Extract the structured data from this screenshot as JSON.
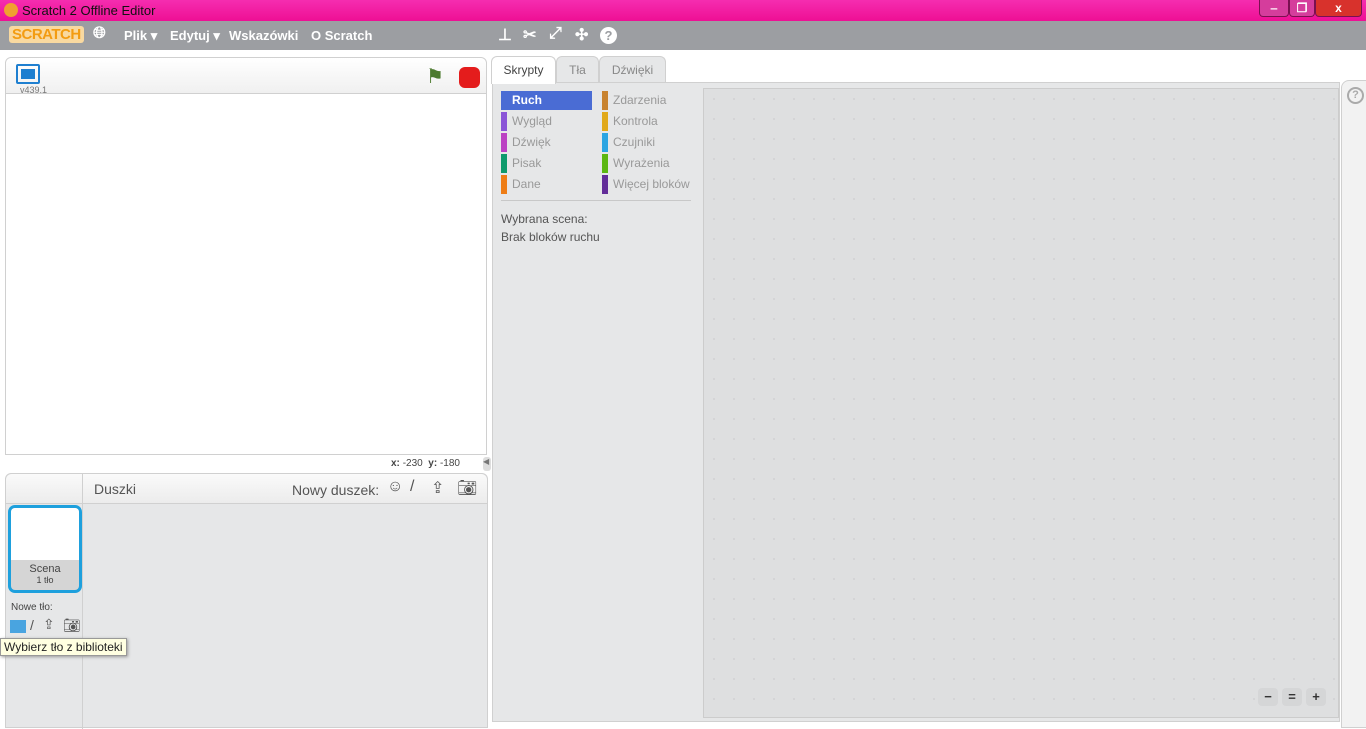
{
  "window": {
    "title": "Scratch 2 Offline Editor",
    "minimize": "‒",
    "restore": "❐",
    "close": "x"
  },
  "menu": {
    "logo": "SCRATCH",
    "items": [
      "Plik ▾",
      "Edytuj ▾",
      "Wskazówki",
      "O Scratch"
    ],
    "tools": [
      "stamp-icon",
      "cut-icon",
      "grow-icon",
      "shrink-icon",
      "help-icon"
    ]
  },
  "stage": {
    "version": "v439.1",
    "coords": {
      "x_label": "x:",
      "x": "-230",
      "y_label": "y:",
      "y": "-180"
    }
  },
  "sprites": {
    "title": "Duszki",
    "new_sprite": "Nowy duszek:",
    "scene": {
      "name": "Scena",
      "backdrops": "1 tło"
    },
    "new_backdrop": "Nowe tło:",
    "tooltip": "Wybierz tło z biblioteki"
  },
  "tabs": [
    "Skrypty",
    "Tła",
    "Dźwięki"
  ],
  "categories": [
    {
      "label": "Ruch",
      "color": "#4a6cd4",
      "selected": true
    },
    {
      "label": "Wygląd",
      "color": "#8a55d7"
    },
    {
      "label": "Dźwięk",
      "color": "#bb42c3"
    },
    {
      "label": "Pisak",
      "color": "#0e9a6c"
    },
    {
      "label": "Dane",
      "color": "#ee7d16"
    },
    {
      "label": "Zdarzenia",
      "color": "#c88330"
    },
    {
      "label": "Kontrola",
      "color": "#e1a91a"
    },
    {
      "label": "Czujniki",
      "color": "#2ca5e2"
    },
    {
      "label": "Wyrażenia",
      "color": "#5cb712"
    },
    {
      "label": "Więcej bloków",
      "color": "#632d99"
    }
  ],
  "palette": {
    "line1": "Wybrana scena:",
    "line2": "Brak bloków ruchu"
  },
  "zoom": [
    "−",
    "=",
    "+"
  ]
}
